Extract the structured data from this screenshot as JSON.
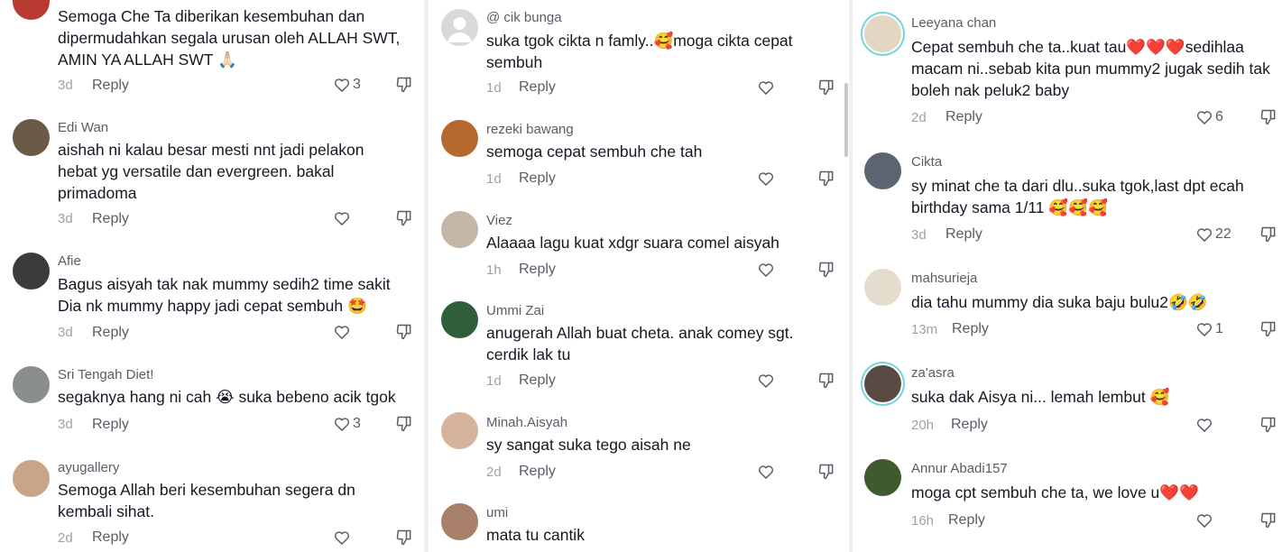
{
  "columns": [
    {
      "comments": [
        {
          "user": "",
          "text": "Semoga Che Ta diberikan kesembuhan dan dipermudahkan segala urusan oleh ALLAH SWT, AMIN YA ALLAH SWT 🙏🏻",
          "time": "3d",
          "reply": "Reply",
          "likes": "3",
          "avatar_color": "#b93a32",
          "ring": false
        },
        {
          "user": "Edi Wan",
          "text": "aishah ni kalau besar mesti nnt jadi pelakon hebat yg versatile dan evergreen. bakal primadoma",
          "time": "3d",
          "reply": "Reply",
          "likes": "",
          "avatar_color": "#6b5a45",
          "ring": false
        },
        {
          "user": "Afie",
          "text": "Bagus aisyah tak nak mummy sedih2 time sakit Dia nk mummy happy jadi cepat sembuh 🤩",
          "time": "3d",
          "reply": "Reply",
          "likes": "",
          "avatar_color": "#3d3a3b",
          "ring": false
        },
        {
          "user": "Sri Tengah Diet!",
          "text": "segaknya hang ni cah 😭 suka bebeno acik tgok",
          "time": "3d",
          "reply": "Reply",
          "likes": "3",
          "avatar_color": "#8b8f8c",
          "ring": false
        },
        {
          "user": "ayugallery",
          "text": "Semoga Allah beri kesembuhan segera dn kembali sihat.",
          "time": "2d",
          "reply": "Reply",
          "likes": "",
          "avatar_color": "#c9a488",
          "ring": false
        }
      ]
    },
    {
      "comments": [
        {
          "user": "@ cik bunga",
          "text": "suka tgok cikta n famly..🥰moga cikta cepat sembuh",
          "time": "1d",
          "reply": "Reply",
          "likes": "",
          "avatar_color": "#d9d9dc",
          "ring": false
        },
        {
          "user": "rezeki bawang",
          "text": "semoga cepat sembuh che tah",
          "time": "1d",
          "reply": "Reply",
          "likes": "",
          "avatar_color": "#b5692f",
          "ring": false
        },
        {
          "user": "Viez",
          "text": "Alaaaa lagu kuat xdgr suara comel aisyah",
          "time": "1h",
          "reply": "Reply",
          "likes": "",
          "avatar_color": "#c4b7a8",
          "ring": false
        },
        {
          "user": "Ummi Zai",
          "text": "anugerah Allah buat cheta. anak comey sgt. cerdik lak tu",
          "time": "1d",
          "reply": "Reply",
          "likes": "",
          "avatar_color": "#2f5f3a",
          "ring": false
        },
        {
          "user": "Minah.Aisyah",
          "text": "sy sangat suka tego aisah ne",
          "time": "2d",
          "reply": "Reply",
          "likes": "",
          "avatar_color": "#d6b49c",
          "ring": false
        },
        {
          "user": "umi",
          "text": "mata tu cantik",
          "time": "",
          "reply": "",
          "likes": "",
          "avatar_color": "#a8806a",
          "ring": false
        }
      ]
    },
    {
      "comments": [
        {
          "user": "Leeyana chan",
          "text": "Cepat sembuh che ta..kuat tau❤️❤️❤️sedihlaa macam ni..sebab kita pun mummy2 jugak sedih tak boleh nak peluk2 baby",
          "time": "2d",
          "reply": "Reply",
          "likes": "6",
          "avatar_color": "#e3d6c2",
          "ring": true
        },
        {
          "user": "Cikta",
          "text": "sy minat che ta dari dlu..suka tgok,last dpt ecah birthday sama 1/11 🥰🥰🥰",
          "time": "3d",
          "reply": "Reply",
          "likes": "22",
          "avatar_color": "#5b6470",
          "ring": false
        },
        {
          "user": "mahsurieja",
          "text": "dia tahu mummy dia suka baju bulu2🤣🤣",
          "time": "13m",
          "reply": "Reply",
          "likes": "1",
          "avatar_color": "#e6dccd",
          "ring": false
        },
        {
          "user": "za'asra",
          "text": "suka dak Aisya ni... lemah lembut 🥰",
          "time": "20h",
          "reply": "Reply",
          "likes": "",
          "avatar_color": "#5a4a44",
          "ring": true
        },
        {
          "user": "Annur Abadi157",
          "text": "moga cpt sembuh che ta, we love u❤️❤️",
          "time": "16h",
          "reply": "Reply",
          "likes": "",
          "avatar_color": "#3f5a2f",
          "ring": false
        }
      ]
    }
  ]
}
